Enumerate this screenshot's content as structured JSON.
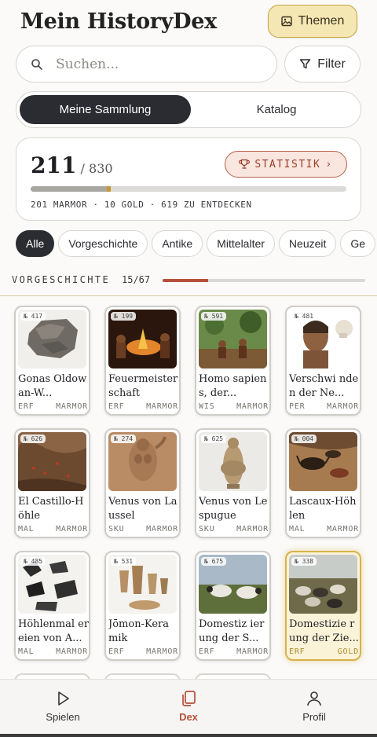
{
  "header": {
    "title": "Mein HistoryDex",
    "themes_label": "Themen",
    "themes_icon": "image-icon"
  },
  "search": {
    "placeholder": "Suchen...",
    "value": "",
    "filter_label": "Filter",
    "filter_icon": "funnel-icon"
  },
  "segments": {
    "active": "Meine Sammlung",
    "inactive": "Katalog"
  },
  "stats": {
    "collected": "211",
    "total": "/ 830",
    "button_label": "STATISTIK",
    "button_icon": "trophy-icon",
    "summary": "201 MARMOR · 10 GOLD · 619 ZU ENTDECKEN",
    "marble_fraction": 0.242,
    "gold_fraction": 0.012,
    "colors": {
      "marble": "#a9a7a2",
      "gold": "#c9962f",
      "track": "#dcdbd8"
    }
  },
  "chips": [
    "Alle",
    "Vorgeschichte",
    "Antike",
    "Mittelalter",
    "Neuzeit",
    "Ge"
  ],
  "section": {
    "name": "VORGESCHICHTE",
    "count": "15/67",
    "progress_fraction": 0.224,
    "accent": "#b5503a"
  },
  "cards": [
    {
      "num": "№ 417",
      "title": "Gonas Oldowan-W...",
      "cat": "ERF",
      "rarity": "MARMOR",
      "gold": false
    },
    {
      "num": "№ 199",
      "title": "Feuermeister schaft",
      "cat": "ERF",
      "rarity": "MARMOR",
      "gold": false
    },
    {
      "num": "№ 591",
      "title": "Homo sapiens, der...",
      "cat": "WIS",
      "rarity": "MARMOR",
      "gold": false
    },
    {
      "num": "№ 481",
      "title": "Verschwi nden der Ne...",
      "cat": "PER",
      "rarity": "MARMOR",
      "gold": false
    },
    {
      "num": "№ 626",
      "title": "El Castillo-H öhle",
      "cat": "MAL",
      "rarity": "MARMOR",
      "gold": false
    },
    {
      "num": "№ 274",
      "title": "Venus von Laussel",
      "cat": "SKU",
      "rarity": "MARMOR",
      "gold": false
    },
    {
      "num": "№ 625",
      "title": "Venus von Lespugue",
      "cat": "SKU",
      "rarity": "MARMOR",
      "gold": false
    },
    {
      "num": "№ 004",
      "title": "Lascaux-Höh len",
      "cat": "MAL",
      "rarity": "MARMOR",
      "gold": false
    },
    {
      "num": "№ 485",
      "title": "Höhlenmal ereien von A...",
      "cat": "MAL",
      "rarity": "MARMOR",
      "gold": false
    },
    {
      "num": "№ 531",
      "title": "Jōmon-Kera mik",
      "cat": "ERF",
      "rarity": "MARMOR",
      "gold": false
    },
    {
      "num": "№ 675",
      "title": "Domestiz ierung der S...",
      "cat": "ERF",
      "rarity": "MARMOR",
      "gold": false
    },
    {
      "num": "№ 338",
      "title": "Domestizie rung der Zie...",
      "cat": "ERF",
      "rarity": "GOLD",
      "gold": true
    }
  ],
  "nav": {
    "play": "Spielen",
    "dex": "Dex",
    "profile": "Profil",
    "play_icon": "play-icon",
    "dex_icon": "cards-icon",
    "profile_icon": "user-icon",
    "active_color": "#b5503a"
  }
}
